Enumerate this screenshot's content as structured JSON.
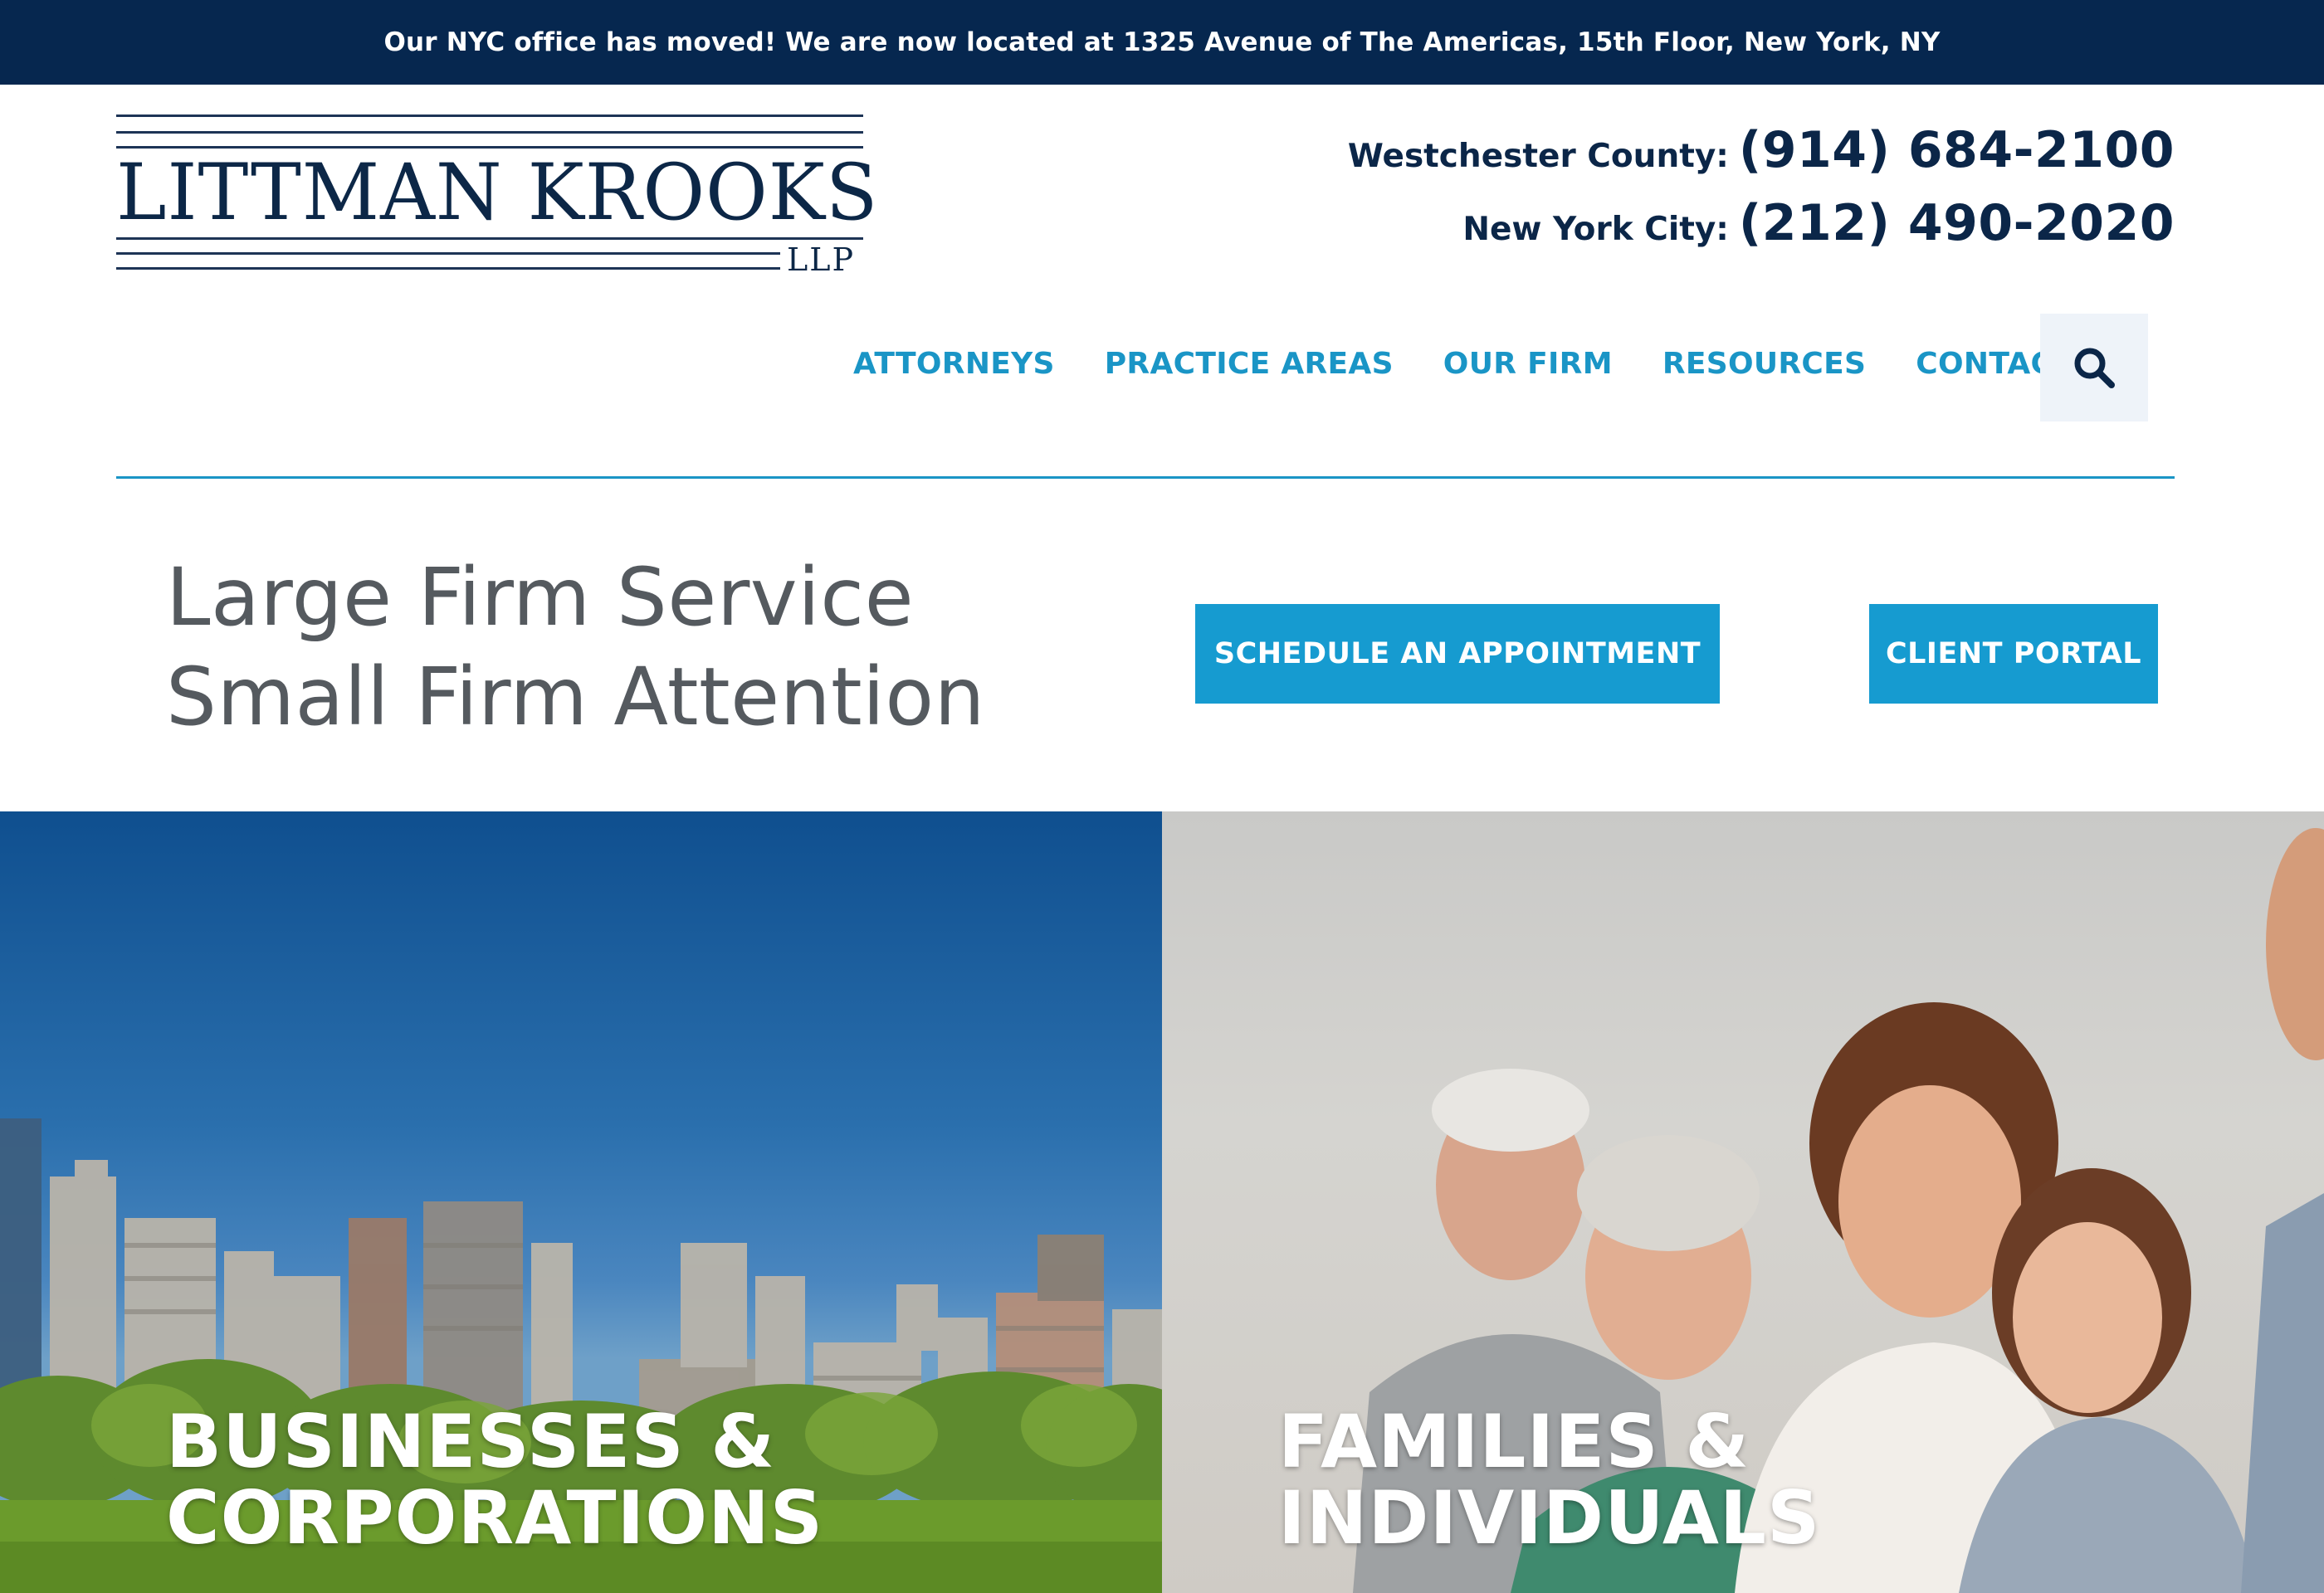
{
  "announcement": {
    "text": "Our NYC office has moved! We are now located at 1325 Avenue of The Americas, 15th Floor, New York, NY"
  },
  "logo": {
    "name": "LITTMAN KROOKS",
    "suffix": "LLP"
  },
  "phones": [
    {
      "label": "Westchester County:",
      "number": "(914) 684-2100"
    },
    {
      "label": "New York City:",
      "number": "(212) 490-2020"
    }
  ],
  "nav": {
    "items": [
      {
        "label": "ATTORNEYS"
      },
      {
        "label": "PRACTICE AREAS"
      },
      {
        "label": "OUR FIRM"
      },
      {
        "label": "RESOURCES"
      },
      {
        "label": "CONTACT US"
      }
    ],
    "search_icon": "search-icon"
  },
  "tagline": {
    "line1": "Large Firm Service",
    "line2": "Small Firm Attention"
  },
  "cta": {
    "schedule_label": "SCHEDULE AN APPOINTMENT",
    "portal_label": "CLIENT PORTAL"
  },
  "panels": {
    "business": {
      "line1": "BUSINESSES &",
      "line2": "CORPORATIONS"
    },
    "family": {
      "line1": "FAMILIES &",
      "line2": "INDIVIDUALS"
    }
  },
  "colors": {
    "announcement_bg": "#06274f",
    "brand_navy": "#0b2648",
    "accent_blue": "#169bd0",
    "nav_link": "#1a95c6"
  }
}
